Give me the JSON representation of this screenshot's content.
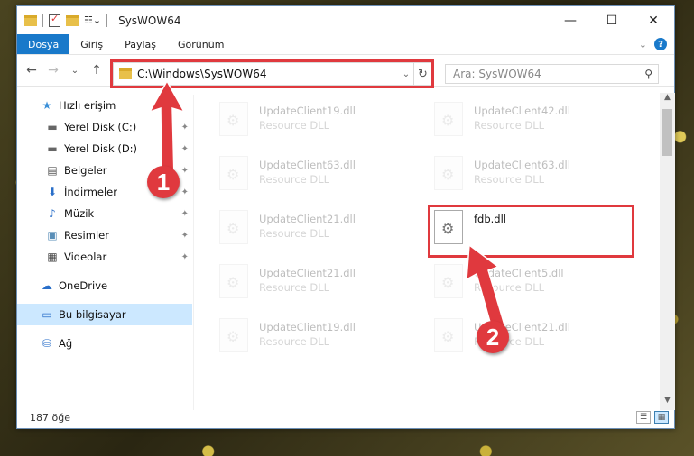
{
  "window": {
    "title": "SysWOW64",
    "controls": {
      "minimize": "—",
      "maximize": "☐",
      "close": "✕"
    }
  },
  "ribbon": {
    "tabs": [
      "Dosya",
      "Giriş",
      "Paylaş",
      "Görünüm"
    ],
    "active_tab": "Dosya",
    "help": "?",
    "collapse": "⌄"
  },
  "nav": {
    "back": "←",
    "forward": "→",
    "recent": "⌄",
    "up": "↑",
    "address": "C:\\Windows\\SysWOW64",
    "address_dropdown": "⌄",
    "refresh": "↻",
    "search_placeholder": "Ara: SysWOW64",
    "search_icon": "⚲"
  },
  "sidebar": {
    "items": [
      {
        "label": "Hızlı erişim",
        "icon": "star-icon",
        "glyph": "★",
        "color": "#3a8fd8",
        "pinned": false
      },
      {
        "label": "Yerel Disk (C:)",
        "icon": "drive-icon",
        "glyph": "▬",
        "color": "#666666",
        "pinned": true
      },
      {
        "label": "Yerel Disk (D:)",
        "icon": "drive-icon",
        "glyph": "▬",
        "color": "#666666",
        "pinned": true
      },
      {
        "label": "Belgeler",
        "icon": "documents-icon",
        "glyph": "▤",
        "color": "#555555",
        "pinned": true
      },
      {
        "label": "İndirmeler",
        "icon": "download-icon",
        "glyph": "⬇",
        "color": "#2a6fc9",
        "pinned": true
      },
      {
        "label": "Müzik",
        "icon": "music-icon",
        "glyph": "♪",
        "color": "#2a6fc9",
        "pinned": true
      },
      {
        "label": "Resimler",
        "icon": "pictures-icon",
        "glyph": "▣",
        "color": "#5a8fb8",
        "pinned": true
      },
      {
        "label": "Videolar",
        "icon": "videos-icon",
        "glyph": "▦",
        "color": "#444444",
        "pinned": true
      },
      {
        "label": "OneDrive",
        "icon": "cloud-icon",
        "glyph": "☁",
        "color": "#2a6fc9",
        "pinned": false
      },
      {
        "label": "Bu bilgisayar",
        "icon": "computer-icon",
        "glyph": "▭",
        "color": "#2a6fc9",
        "pinned": false
      },
      {
        "label": "Ağ",
        "icon": "network-icon",
        "glyph": "⛁",
        "color": "#2a6fc9",
        "pinned": false
      }
    ],
    "pin_glyph": "📌"
  },
  "files": [
    {
      "name": "UpdateClient19.dll",
      "type": "Resource DLL"
    },
    {
      "name": "UpdateClient42.dll",
      "type": "Resource DLL"
    },
    {
      "name": "UpdateClient63.dll",
      "type": "Resource DLL"
    },
    {
      "name": "UpdateClient63.dll",
      "type": "Resource DLL"
    },
    {
      "name": "UpdateClient21.dll",
      "type": "Resource DLL"
    },
    {
      "name": "fdb.dll",
      "type": ""
    },
    {
      "name": "UpdateClient21.dll",
      "type": "Resource DLL"
    },
    {
      "name": "UpdateClient5.dll",
      "type": "Resource DLL"
    },
    {
      "name": "UpdateClient19.dll",
      "type": "Resource DLL"
    },
    {
      "name": "UpdateClient21.dll",
      "type": "Resource DLL"
    }
  ],
  "status": {
    "count": "187 öğe"
  },
  "annotations": {
    "step1": "1",
    "step2": "2",
    "highlight_color": "#e0393e"
  }
}
